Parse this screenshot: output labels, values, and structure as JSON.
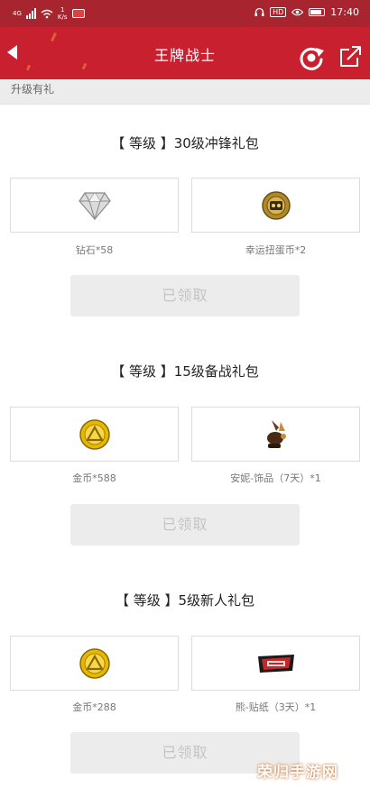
{
  "status_bar": {
    "network": "4G",
    "speed_value": "1",
    "speed_unit": "K/s",
    "hd": "HD",
    "time": "17:40"
  },
  "header": {
    "title": "王牌战士"
  },
  "sub_header": {
    "label": "升级有礼"
  },
  "sections": [
    {
      "title": "【 等级 】30级冲锋礼包",
      "items": [
        {
          "icon": "diamond-icon",
          "label": "钻石*58"
        },
        {
          "icon": "lucky-coin-icon",
          "label": "幸运扭蛋币*2"
        }
      ],
      "button_label": "已领取"
    },
    {
      "title": "【 等级 】15级备战礼包",
      "items": [
        {
          "icon": "gold-coin-icon",
          "label": "金币*588"
        },
        {
          "icon": "ornament-icon",
          "label": "安妮-饰品（7天）*1"
        }
      ],
      "button_label": "已领取"
    },
    {
      "title": "【 等级 】5级新人礼包",
      "items": [
        {
          "icon": "gold-coin-icon",
          "label": "金币*288"
        },
        {
          "icon": "sticker-icon",
          "label": "熊-贴纸（3天）*1"
        }
      ],
      "button_label": "已领取"
    }
  ],
  "watermark": "荣归手游网",
  "colors": {
    "header": "#c8202e",
    "status_bar": "#a8252f",
    "disabled_button": "#ececec"
  }
}
